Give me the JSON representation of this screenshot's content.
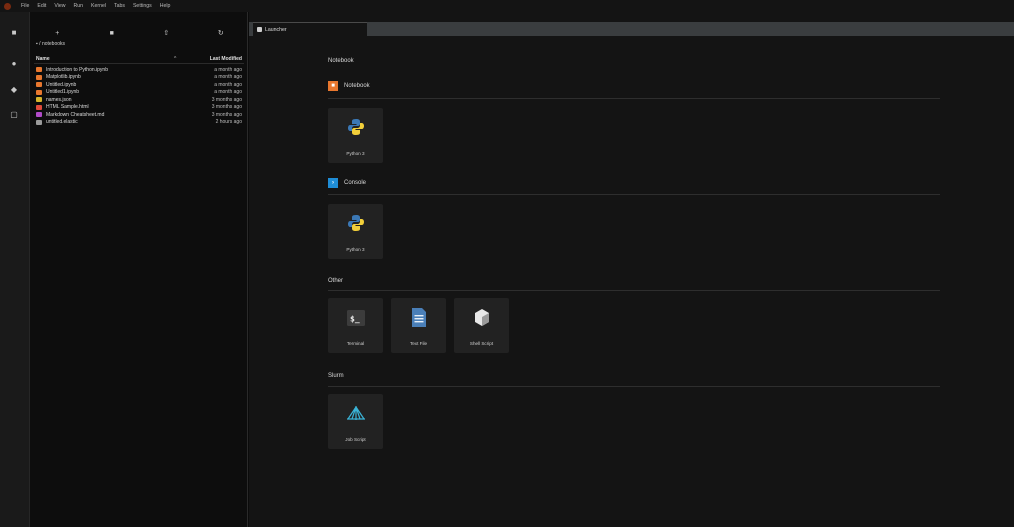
{
  "menu": [
    "File",
    "Edit",
    "View",
    "Run",
    "Kernel",
    "Tabs",
    "Settings",
    "Help"
  ],
  "filebrowser": {
    "breadcrumb": "▪ / notebooks",
    "header": {
      "name": "Name",
      "sort": "^",
      "modified": "Last Modified"
    },
    "files": [
      {
        "name": "Introduction to Python.ipynb",
        "modified": "a month ago",
        "color": "#e8772e"
      },
      {
        "name": "Matplotlib.ipynb",
        "modified": "a month ago",
        "color": "#e8772e"
      },
      {
        "name": "Untitled.ipynb",
        "modified": "a month ago",
        "color": "#e8772e"
      },
      {
        "name": "Untitled1.ipynb",
        "modified": "a month ago",
        "color": "#e8772e"
      },
      {
        "name": "names.json",
        "modified": "3 months ago",
        "color": "#d6b42c"
      },
      {
        "name": "HTML Sample.html",
        "modified": "3 months ago",
        "color": "#e24a3a"
      },
      {
        "name": "Markdown Cheatsheet.md",
        "modified": "3 months ago",
        "color": "#b04bc8"
      },
      {
        "name": "untitled.elastic",
        "modified": "2 hours ago",
        "color": "#9a9a9a"
      }
    ]
  },
  "tab": {
    "label": "Launcher"
  },
  "launcher": {
    "notebook_section": "Notebook",
    "notebook_kernel": "Notebook",
    "notebook_card": "Python 3",
    "console_section": "Console",
    "console_card": "Python 3",
    "other_section": "Other",
    "other_cards": [
      "Terminal",
      "Text File",
      "Shell Script"
    ],
    "slurm_section": "Slurm",
    "slurm_card": "Job Script"
  },
  "colors": {
    "notebook_badge": "#e8772e",
    "console_badge": "#1f8dd6",
    "slurm_icon": "#3ab3d6"
  }
}
